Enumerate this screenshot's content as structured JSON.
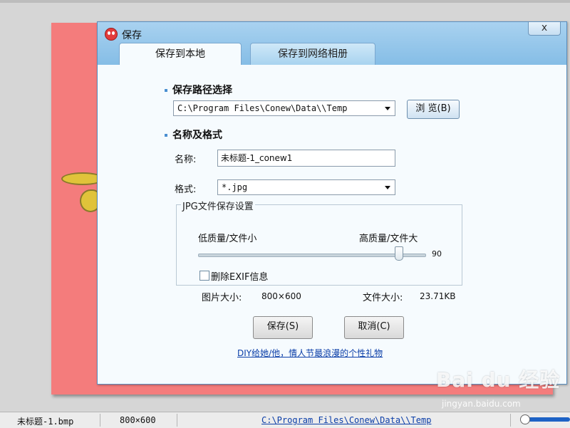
{
  "dialog": {
    "title": "保存",
    "close_label": "x",
    "tabs": [
      {
        "label": "保存到本地",
        "active": true
      },
      {
        "label": "保存到网络相册",
        "active": false
      }
    ]
  },
  "path_section": {
    "title": "保存路径选择",
    "path_value": "C:\\Program Files\\Conew\\Data\\\\Temp",
    "browse_label": "浏 览(B)"
  },
  "name_section": {
    "title": "名称及格式",
    "name_label": "名称:",
    "name_value": "未标题-1_conew1",
    "format_label": "格式:",
    "format_value": "*.jpg"
  },
  "jpg_settings": {
    "group_title": "JPG文件保存设置",
    "low_label": "低质量/文件小",
    "high_label": "高质量/文件大",
    "quality_value": "90",
    "quality_fraction": 0.9,
    "exif_label": "删除EXIF信息",
    "exif_checked": false
  },
  "info": {
    "image_size_label": "图片大小:",
    "image_size_value": "800×600",
    "file_size_label": "文件大小:",
    "file_size_value": "23.71KB"
  },
  "buttons": {
    "save_label": "保存(S)",
    "cancel_label": "取消(C)"
  },
  "promo_link": "DIY给她/他，情人节最浪漫的个性礼物",
  "statusbar": {
    "filename": "未标题-1.bmp",
    "dimensions": "800×600",
    "path": "C:\\Program Files\\Conew\\Data\\\\Temp"
  },
  "watermark": {
    "logo": "Bai du 经验",
    "url": "jingyan.baidu.com"
  },
  "colors": {
    "accent": "#4a8fd1",
    "canvas_image": "#f47c7c",
    "link": "#0b3ea8"
  }
}
